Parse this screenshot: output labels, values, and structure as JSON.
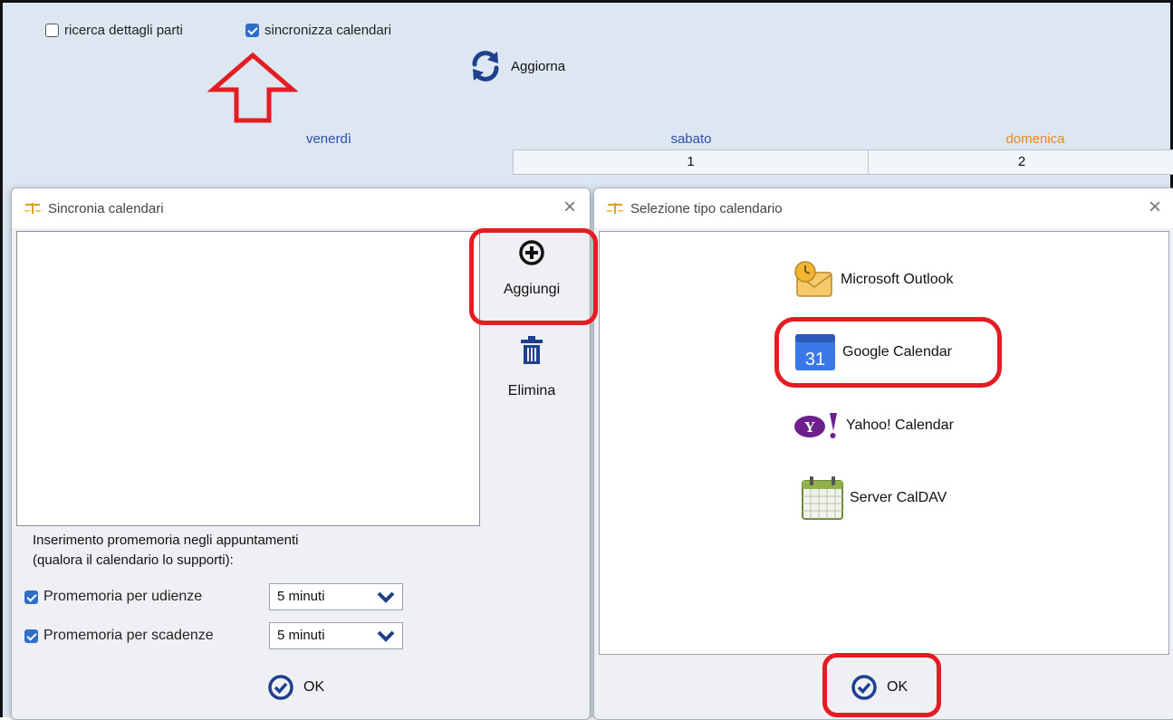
{
  "top": {
    "checkbox_parti": {
      "label": "ricerca dettagli parti",
      "checked": false
    },
    "checkbox_sync": {
      "label": "sincronizza calendari",
      "checked": true
    },
    "refresh_label": "Aggiorna"
  },
  "calendar": {
    "days": [
      "venerdì",
      "sabato",
      "domenica"
    ],
    "dates": [
      "1",
      "2"
    ],
    "colors": {
      "weekday": "#2b4fa8",
      "sunday": "#e8891c"
    }
  },
  "sync_dialog": {
    "title": "Sincronia calendari",
    "add_label": "Aggiungi",
    "delete_label": "Elimina",
    "reminder_text_1": "Inserimento promemoria negli appuntamenti",
    "reminder_text_2": "(qualora il calendario lo supporti):",
    "reminder_udienze": {
      "label": "Promemoria per udienze",
      "checked": true,
      "value": "5 minuti"
    },
    "reminder_scadenze": {
      "label": "Promemoria per scadenze",
      "checked": true,
      "value": "5 minuti"
    },
    "ok_label": "OK"
  },
  "type_dialog": {
    "title": "Selezione tipo calendario",
    "options": [
      {
        "label": "Microsoft Outlook",
        "icon": "outlook-icon"
      },
      {
        "label": "Google Calendar",
        "icon": "google-calendar-icon",
        "icon_text": "31"
      },
      {
        "label": "Yahoo! Calendar",
        "icon": "yahoo-icon",
        "icon_text": "Y!"
      },
      {
        "label": "Server CalDAV",
        "icon": "caldav-icon"
      }
    ],
    "ok_label": "OK"
  },
  "accent": {
    "blue": "#1f3f8f",
    "highlight": "#e41c24"
  }
}
